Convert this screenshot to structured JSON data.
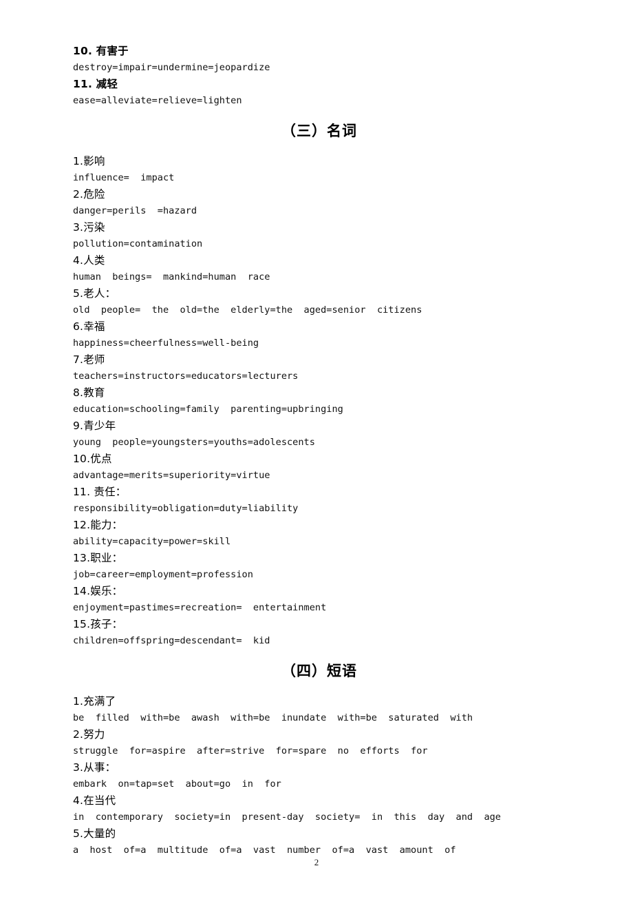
{
  "document": {
    "page_number": "2",
    "background_color": "#ffffff",
    "text_color": "#000000"
  },
  "top_entries": [
    {
      "heading": "10. 有害于",
      "bold": true,
      "synonyms": "destroy=impair=undermine=jeopardize"
    },
    {
      "heading": "11. 减轻",
      "bold": true,
      "synonyms": "ease=alleviate=relieve=lighten"
    }
  ],
  "sections": [
    {
      "heading": "（三）名词",
      "entries": [
        {
          "heading": "1.影响",
          "synonyms": "influence=  impact"
        },
        {
          "heading": "2.危险",
          "synonyms": "danger=perils  =hazard"
        },
        {
          "heading": "3.污染",
          "synonyms": "pollution=contamination"
        },
        {
          "heading": "4.人类",
          "synonyms": "human  beings=  mankind=human  race"
        },
        {
          "heading": "5.老人：",
          "synonyms": "old  people=  the  old=the  elderly=the  aged=senior  citizens"
        },
        {
          "heading": "6.幸福",
          "synonyms": "happiness=cheerfulness=well-being"
        },
        {
          "heading": "7.老师",
          "synonyms": "teachers=instructors=educators=lecturers"
        },
        {
          "heading": "8.教育",
          "synonyms": "education=schooling=family  parenting=upbringing"
        },
        {
          "heading": "9.青少年",
          "synonyms": "young  people=youngsters=youths=adolescents"
        },
        {
          "heading": "10.优点",
          "synonyms": "advantage=merits=superiority=virtue"
        },
        {
          "heading": "11. 责任：",
          "synonyms": "responsibility=obligation=duty=liability"
        },
        {
          "heading": "12.能力：",
          "synonyms": "ability=capacity=power=skill"
        },
        {
          "heading": "13.职业：",
          "synonyms": "job=career=employment=profession"
        },
        {
          "heading": "14.娱乐：",
          "synonyms": "enjoyment=pastimes=recreation=  entertainment"
        },
        {
          "heading": "15.孩子：",
          "synonyms": "children=offspring=descendant=  kid"
        }
      ]
    },
    {
      "heading": "（四）短语",
      "entries": [
        {
          "heading": "1.充满了",
          "synonyms": "be  filled  with=be  awash  with=be  inundate  with=be  saturated  with"
        },
        {
          "heading": "2.努力",
          "synonyms": "struggle  for=aspire  after=strive  for=spare  no  efforts  for"
        },
        {
          "heading": "3.从事：",
          "synonyms": "embark  on=tap=set  about=go  in  for"
        },
        {
          "heading": "4.在当代",
          "synonyms": "in  contemporary  society=in  present-day  society=  in  this  day  and  age"
        },
        {
          "heading": "5.大量的",
          "synonyms": "a  host  of=a  multitude  of=a  vast  number  of=a  vast  amount  of"
        }
      ]
    }
  ]
}
